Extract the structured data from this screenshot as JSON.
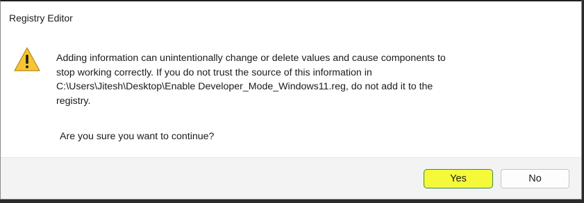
{
  "window": {
    "title": "Registry Editor"
  },
  "message": {
    "icon": "warning-icon",
    "lines": [
      "Adding information can unintentionally change or delete values and cause components to",
      "stop working correctly. If you do not trust the source of this information in",
      "C:\\Users\\Jitesh\\Desktop\\Enable Developer_Mode_Windows11.reg, do not add it to the",
      "registry."
    ],
    "question": "Are you sure you want to continue?"
  },
  "buttons": {
    "yes_label": "Yes",
    "no_label": "No"
  },
  "colors": {
    "warning_fill": "#f7c531",
    "yes_highlight": "#f4f93a"
  }
}
